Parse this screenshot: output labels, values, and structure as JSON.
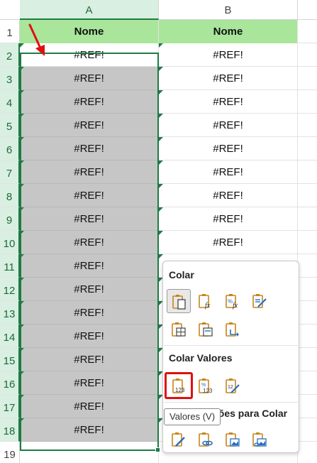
{
  "columns": {
    "a": "A",
    "b": "B"
  },
  "rows": [
    {
      "num": "1",
      "a": "Nome",
      "b": "Nome"
    },
    {
      "num": "2",
      "a": "#REF!",
      "b": "#REF!"
    },
    {
      "num": "3",
      "a": "#REF!",
      "b": "#REF!"
    },
    {
      "num": "4",
      "a": "#REF!",
      "b": "#REF!"
    },
    {
      "num": "5",
      "a": "#REF!",
      "b": "#REF!"
    },
    {
      "num": "6",
      "a": "#REF!",
      "b": "#REF!"
    },
    {
      "num": "7",
      "a": "#REF!",
      "b": "#REF!"
    },
    {
      "num": "8",
      "a": "#REF!",
      "b": "#REF!"
    },
    {
      "num": "9",
      "a": "#REF!",
      "b": "#REF!"
    },
    {
      "num": "10",
      "a": "#REF!",
      "b": "#REF!"
    },
    {
      "num": "11",
      "a": "#REF!",
      "b": ""
    },
    {
      "num": "12",
      "a": "#REF!",
      "b": ""
    },
    {
      "num": "13",
      "a": "#REF!",
      "b": ""
    },
    {
      "num": "14",
      "a": "#REF!",
      "b": ""
    },
    {
      "num": "15",
      "a": "#REF!",
      "b": ""
    },
    {
      "num": "16",
      "a": "#REF!",
      "b": ""
    },
    {
      "num": "17",
      "a": "#REF!",
      "b": ""
    },
    {
      "num": "18",
      "a": "#REF!",
      "b": ""
    },
    {
      "num": "19",
      "a": "",
      "b": ""
    }
  ],
  "paste_menu": {
    "section_paste": "Colar",
    "section_values": "Colar Valores",
    "section_other": "Outras Opções para Colar",
    "section_other_visible": "ções para Colar",
    "tooltip": "Valores (V)"
  },
  "colors": {
    "header_fill": "#a9e59a",
    "selection_border": "#1e7b45",
    "selected_fill": "#c6c6c6",
    "highlight_box": "#e01010",
    "arrow": "#e01010",
    "icon_orange": "#c8841a",
    "icon_blue": "#2a6ebd"
  }
}
